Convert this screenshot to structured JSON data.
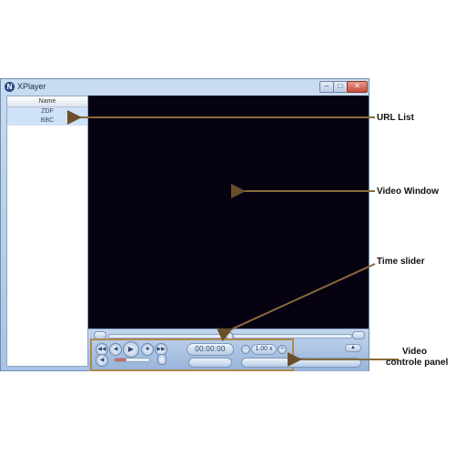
{
  "window": {
    "title": "XPlayer",
    "icon": "app-logo-icon",
    "accent": "#b0884f"
  },
  "url_list": {
    "header": "Name",
    "items": [
      {
        "label": "ZDF"
      },
      {
        "label": "BBC"
      }
    ]
  },
  "controls": {
    "time": "00:00:00",
    "speed": "1.00 x",
    "volume_fraction": 0.35,
    "time_fraction": 0.5
  },
  "annotations": {
    "url_list": "URL List",
    "video_window": "Video Window",
    "time_slider": "Time slider",
    "video_panel_line1": "Video",
    "video_panel_line2": "controle panel"
  }
}
